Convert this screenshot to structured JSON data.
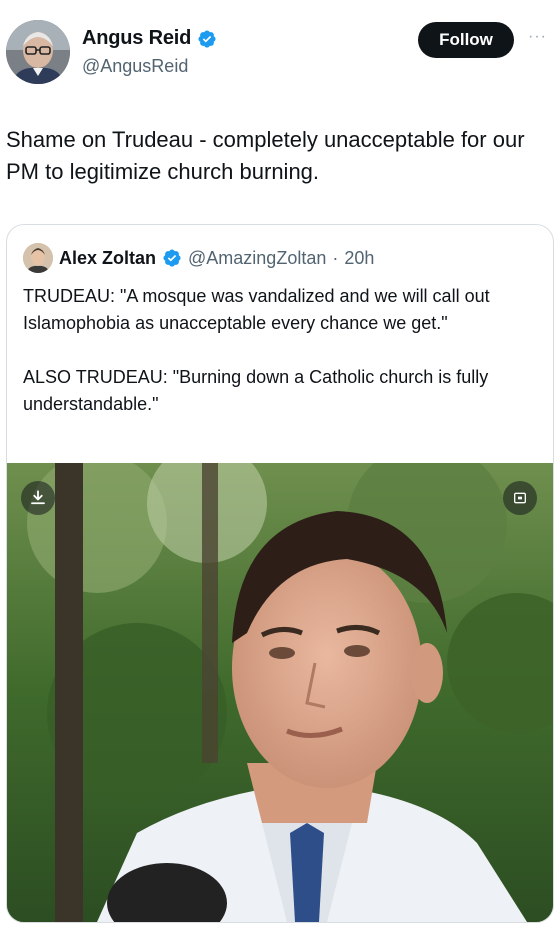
{
  "author": {
    "display_name": "Angus Reid",
    "handle": "@AngusReid",
    "verified": true,
    "avatar_icon": "profile-photo"
  },
  "follow_label": "Follow",
  "more_label": "···",
  "tweet_text": "Shame on Trudeau - completely unacceptable for our PM to legitimize church burning.",
  "quoted": {
    "display_name": "Alex Zoltan",
    "handle": "@AmazingZoltan",
    "separator": "·",
    "time": "20h",
    "verified": true,
    "paragraphs": [
      "TRUDEAU: \"A mosque was vandalized and we will call out Islamophobia as unacceptable every chance we get.\"",
      "ALSO TRUDEAU: \"Burning down a Catholic church is fully understandable.\""
    ],
    "media": {
      "type": "video-still",
      "download_icon": "download-icon",
      "expand_icon": "expand-icon"
    }
  },
  "colors": {
    "verified_blue": "#1d9bf0",
    "text": "#0f1419",
    "secondary": "#536471",
    "follow_bg": "#0f1419"
  }
}
